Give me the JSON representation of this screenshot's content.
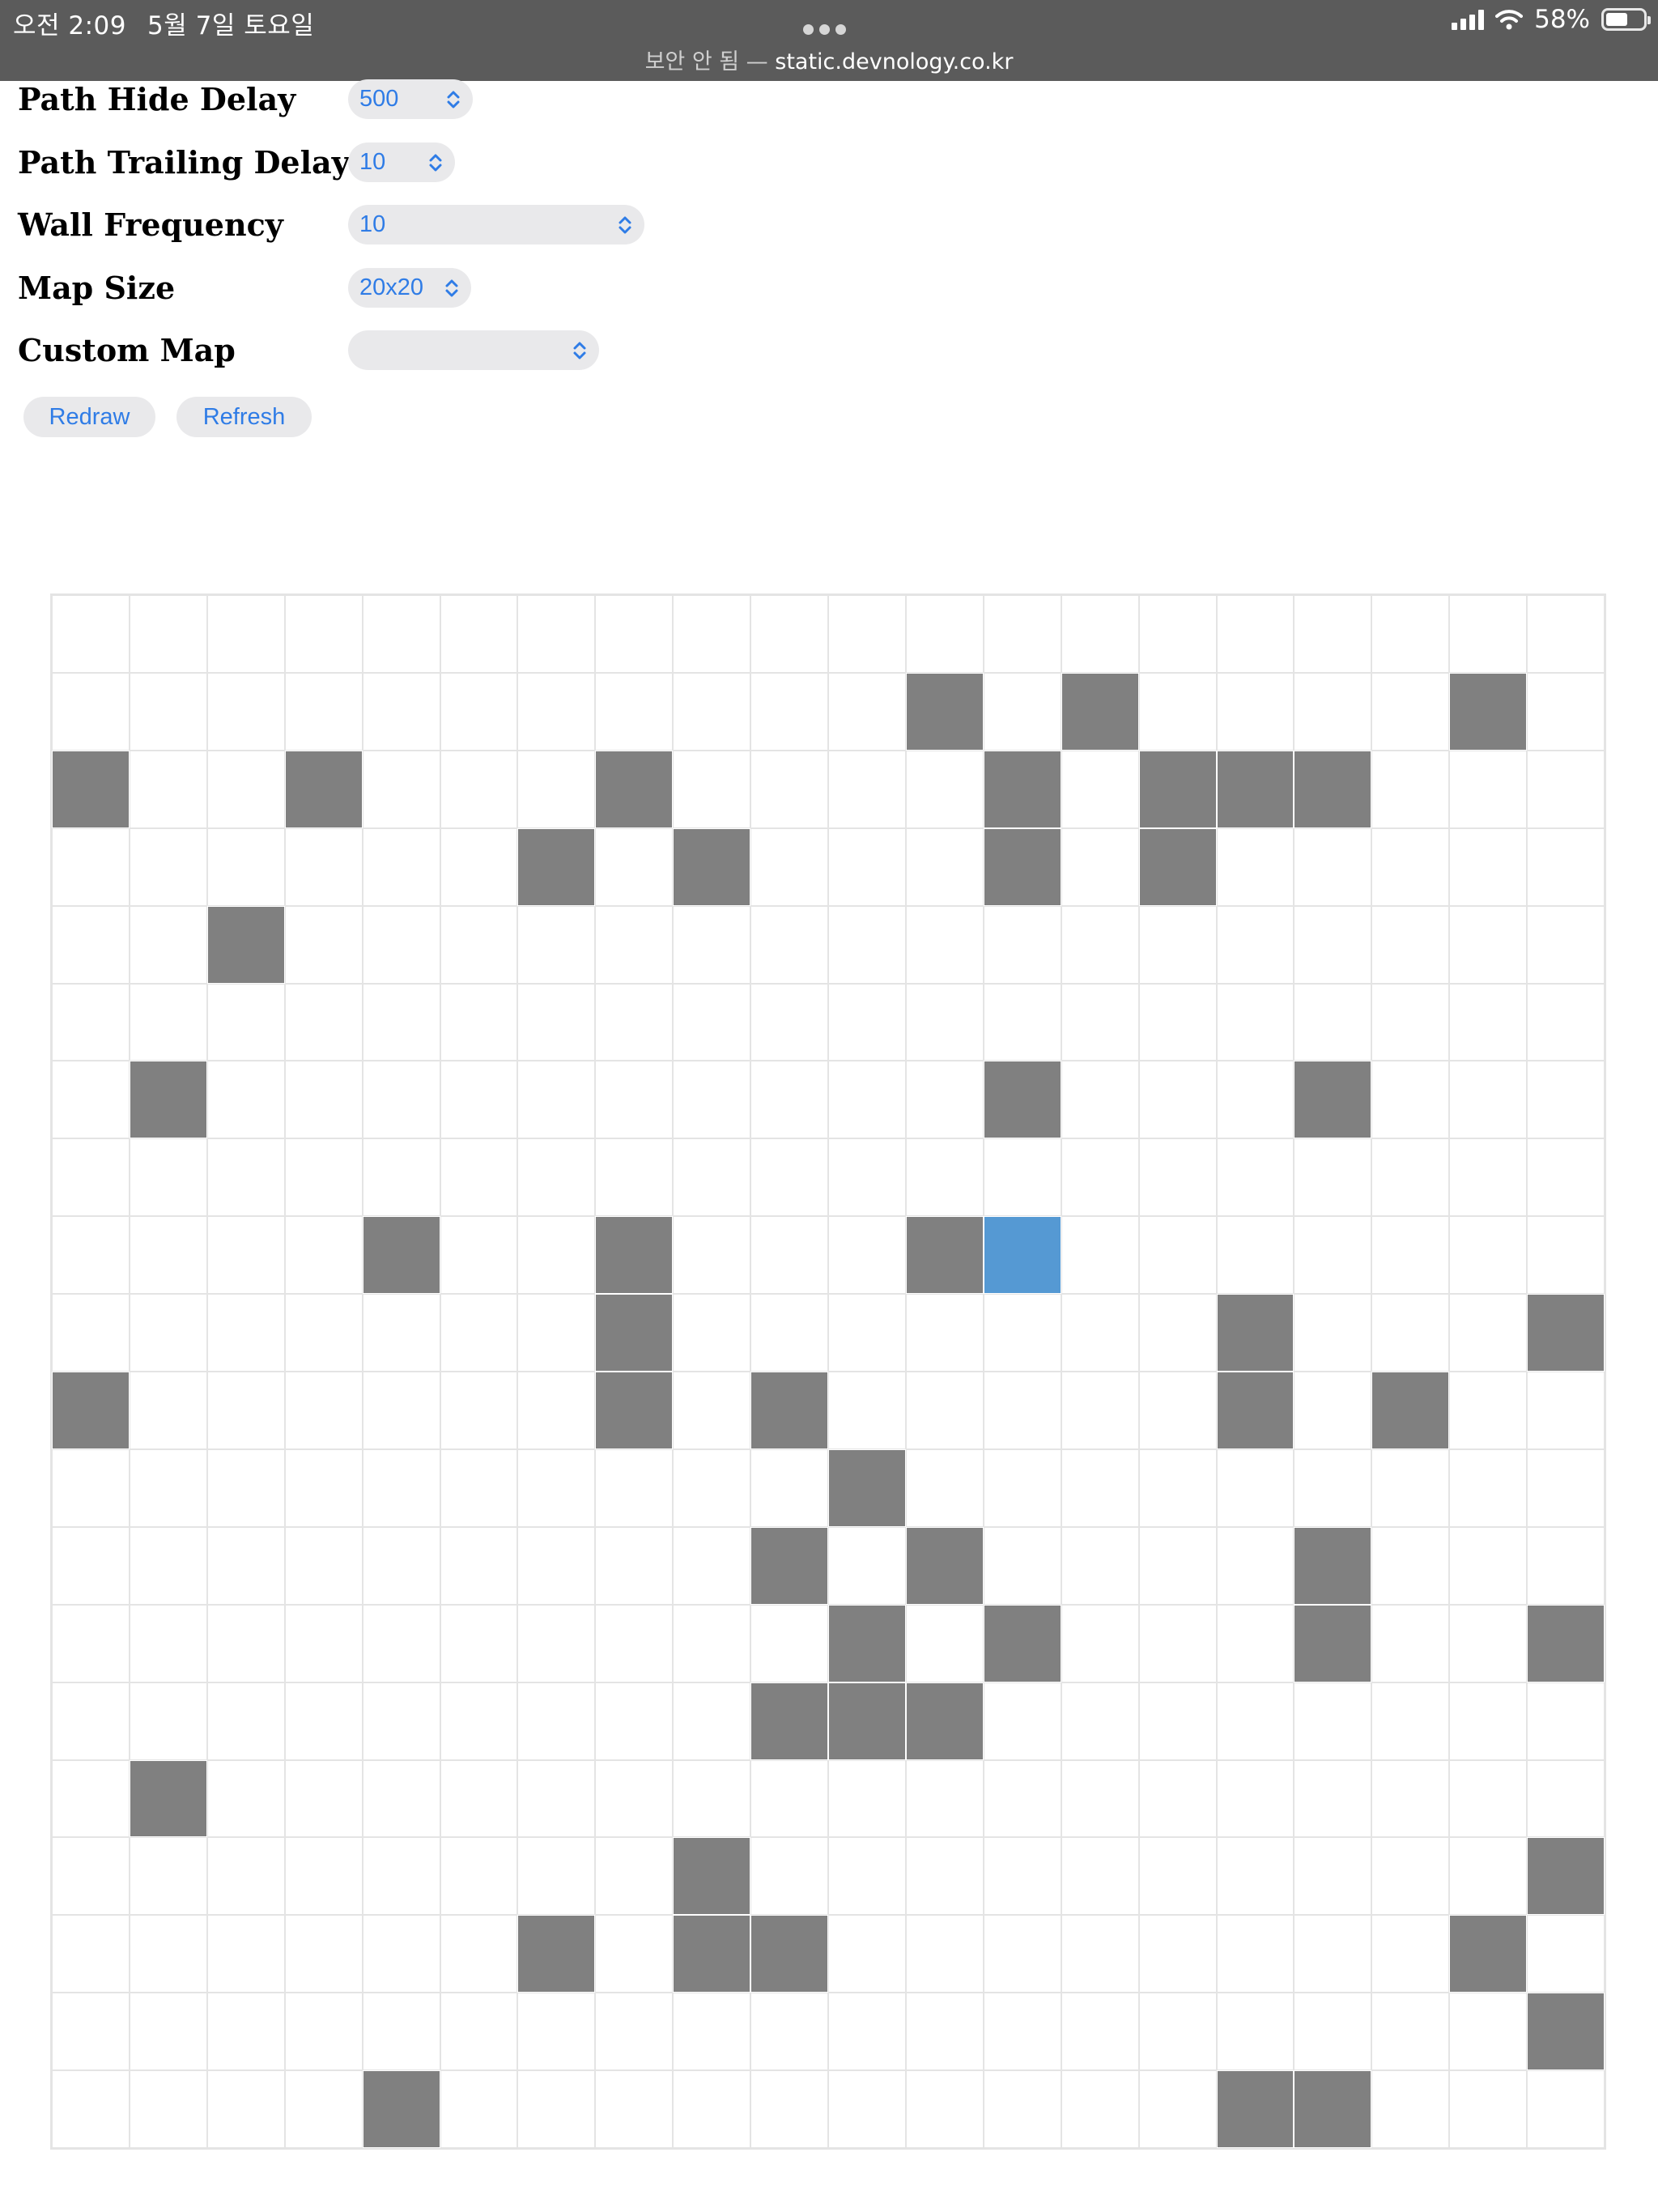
{
  "status_bar": {
    "time": "오전 2:09",
    "date": "5월 7일 토요일",
    "battery": "58%",
    "battery_level": 0.58,
    "url_security": "보안 안 됨",
    "url_separator": " — ",
    "url_host": "static.devnology.co.kr"
  },
  "settings": {
    "path_hide_delay": {
      "label": "Path Hide Delay",
      "value": "500"
    },
    "path_trailing_delay": {
      "label": "Path Trailing Delay",
      "value": "10"
    },
    "wall_frequency": {
      "label": "Wall Frequency",
      "value": "10"
    },
    "map_size": {
      "label": "Map Size",
      "value": "20x20"
    },
    "custom_map": {
      "label": "Custom Map",
      "value": ""
    }
  },
  "buttons": {
    "redraw": "Redraw",
    "refresh": "Refresh"
  },
  "maze": {
    "rows": 20,
    "cols": 20,
    "current": [
      8,
      12
    ],
    "walls": [
      [
        1,
        11
      ],
      [
        1,
        13
      ],
      [
        1,
        18
      ],
      [
        2,
        0
      ],
      [
        2,
        3
      ],
      [
        2,
        7
      ],
      [
        2,
        12
      ],
      [
        2,
        14
      ],
      [
        2,
        15
      ],
      [
        2,
        16
      ],
      [
        3,
        6
      ],
      [
        3,
        8
      ],
      [
        3,
        12
      ],
      [
        3,
        14
      ],
      [
        4,
        2
      ],
      [
        6,
        1
      ],
      [
        6,
        12
      ],
      [
        6,
        16
      ],
      [
        8,
        4
      ],
      [
        8,
        7
      ],
      [
        8,
        11
      ],
      [
        9,
        7
      ],
      [
        9,
        15
      ],
      [
        9,
        19
      ],
      [
        10,
        0
      ],
      [
        10,
        7
      ],
      [
        10,
        9
      ],
      [
        10,
        15
      ],
      [
        10,
        17
      ],
      [
        11,
        10
      ],
      [
        12,
        9
      ],
      [
        12,
        11
      ],
      [
        12,
        16
      ],
      [
        13,
        10
      ],
      [
        13,
        12
      ],
      [
        13,
        16
      ],
      [
        13,
        19
      ],
      [
        14,
        9
      ],
      [
        14,
        10
      ],
      [
        14,
        11
      ],
      [
        15,
        1
      ],
      [
        16,
        8
      ],
      [
        16,
        19
      ],
      [
        17,
        6
      ],
      [
        17,
        8
      ],
      [
        17,
        9
      ],
      [
        17,
        18
      ],
      [
        18,
        19
      ],
      [
        19,
        4
      ],
      [
        19,
        15
      ],
      [
        19,
        16
      ]
    ]
  }
}
